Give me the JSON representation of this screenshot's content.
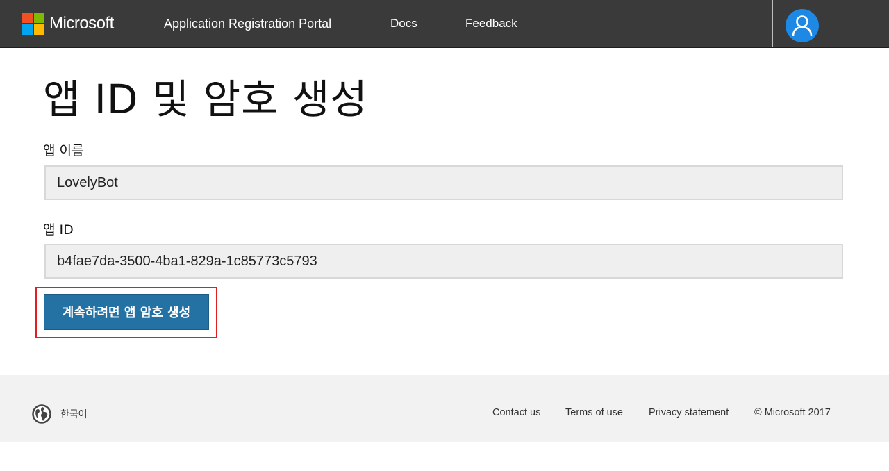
{
  "header": {
    "brand": "Microsoft",
    "nav": {
      "portal": "Application Registration Portal",
      "docs": "Docs",
      "feedback": "Feedback"
    },
    "avatar_icon": "user-icon"
  },
  "main": {
    "title": "앱 ID 및 암호 생성",
    "app_name": {
      "label": "앱 이름",
      "value": "LovelyBot"
    },
    "app_id": {
      "label": "앱 ID",
      "value": "b4fae7da-3500-4ba1-829a-1c85773c5793"
    },
    "generate_button": "계속하려면 앱 암호 생성"
  },
  "footer": {
    "language": "한국어",
    "links": {
      "contact": "Contact us",
      "terms": "Terms of use",
      "privacy": "Privacy statement"
    },
    "copyright": "© Microsoft 2017"
  },
  "colors": {
    "topbar": "#3a3a3a",
    "accent_button": "#2471a3",
    "avatar": "#1e88e5",
    "highlight": "#e02020"
  }
}
